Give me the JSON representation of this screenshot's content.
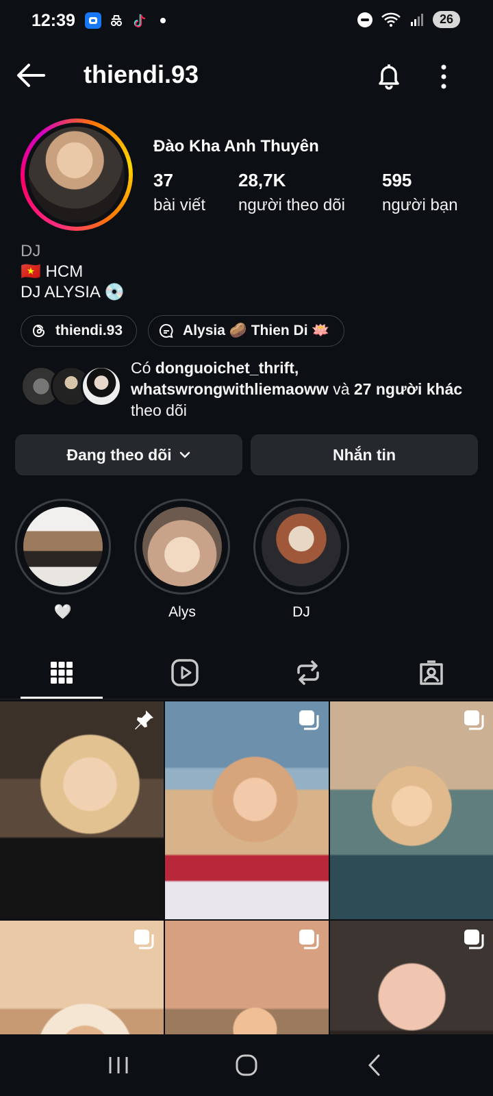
{
  "status_bar": {
    "time": "12:39",
    "battery": "26",
    "apps": [
      "messenger-icon",
      "incognito-icon",
      "tiktok-icon"
    ]
  },
  "header": {
    "username": "thiendi.93"
  },
  "profile": {
    "full_name": "Đào Kha Anh Thuyên",
    "stats": [
      {
        "value": "37",
        "label": "bài viết"
      },
      {
        "value": "28,7K",
        "label": "người theo dõi"
      },
      {
        "value": "595",
        "label": "người bạn"
      }
    ],
    "category": "DJ",
    "bio_lines": [
      "🇻🇳 HCM",
      "DJ ALYSIA 💿"
    ]
  },
  "chips": [
    {
      "label": "thiendi.93",
      "icon": "threads-icon"
    },
    {
      "label": "Alysia 🥔 Thien Di 🪷",
      "icon": "messenger-channel-icon"
    }
  ],
  "mutuals": {
    "prefix": "Có ",
    "user1": "donguoichet_thrift,",
    "user2": "whatswrongwithliemaoww",
    "conj": " và ",
    "others": "27 người khác",
    "suffix": " theo dõi"
  },
  "actions": {
    "following_label": "Đang theo dõi",
    "message_label": "Nhắn tin"
  },
  "highlights": [
    {
      "label": "🤍"
    },
    {
      "label": "Alys"
    },
    {
      "label": "DJ"
    }
  ],
  "tabs": [
    "grid-icon",
    "reels-icon",
    "reposts-icon",
    "tagged-icon"
  ],
  "posts": [
    {
      "badge": "pin-icon"
    },
    {
      "badge": "carousel-icon"
    },
    {
      "badge": "carousel-icon"
    },
    {
      "badge": "carousel-icon"
    },
    {
      "badge": "carousel-icon"
    },
    {
      "badge": "carousel-icon"
    }
  ],
  "colors": {
    "background": "#0c1014",
    "button": "#25292e",
    "story_ring_start": "#ffd600",
    "story_ring_end": "#ff0069"
  }
}
